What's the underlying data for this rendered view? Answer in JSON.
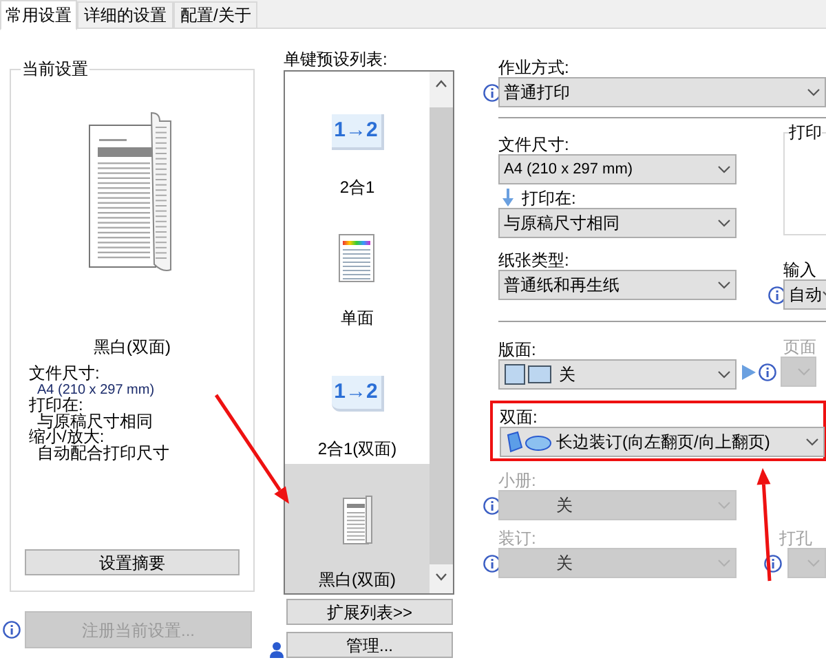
{
  "tabs": [
    {
      "label": "常用设置",
      "selected": true
    },
    {
      "label": "详细的设置",
      "selected": false
    },
    {
      "label": "配置/关于",
      "selected": false
    }
  ],
  "current_settings": {
    "title": "当前设置",
    "mode": "黑白(双面)",
    "details": [
      {
        "label": "文件尺寸:",
        "value": "A4 (210 x 297 mm)"
      },
      {
        "label": "打印在:",
        "value": "与原稿尺寸相同"
      },
      {
        "label": "缩小/放大:",
        "value": "自动配合打印尺寸"
      }
    ],
    "button": "设置摘要"
  },
  "register_button": {
    "label": "注册当前设置...",
    "disabled": true
  },
  "presets": {
    "label": "单键预设列表:",
    "items": [
      {
        "kind": "two_in_one",
        "icon_text": "1→2",
        "label": "2合1",
        "selected": false
      },
      {
        "kind": "color_page",
        "label": "单面",
        "selected": false
      },
      {
        "kind": "two_in_one_duplex",
        "icon_text": "1→2",
        "label": "2合1(双面)",
        "selected": false
      },
      {
        "kind": "mono_duplex",
        "label": "黑白(双面)",
        "selected": true
      }
    ],
    "arrow": true,
    "expand_button": "扩展列表>>",
    "manage_button": "管理..."
  },
  "job": {
    "label": "作业方式:",
    "value": "普通打印",
    "info": true
  },
  "paper_size": {
    "label": "文件尺寸:",
    "value": "A4 (210 x 297 mm)"
  },
  "print_group": {
    "title": "打印"
  },
  "print_on": {
    "label": "打印在:",
    "value": "与原稿尺寸相同"
  },
  "paper_type": {
    "label": "纸张类型:",
    "value": "普通纸和再生纸"
  },
  "input": {
    "label": "输入",
    "value": "自动",
    "info": true
  },
  "layout": {
    "label": "版面:",
    "value": "关"
  },
  "page": {
    "label": "页面",
    "disabled": true,
    "info": true
  },
  "duplex": {
    "label": "双面:",
    "value": "长边装订(向左翻页/向上翻页)",
    "highlighted": true,
    "arrow": true
  },
  "booklet": {
    "label": "小册:",
    "value": "关",
    "disabled": true,
    "info": true
  },
  "binding": {
    "label": "装订:",
    "value": "关",
    "disabled": true,
    "info": true
  },
  "punch": {
    "label": "打孔",
    "disabled": true,
    "info": true
  }
}
